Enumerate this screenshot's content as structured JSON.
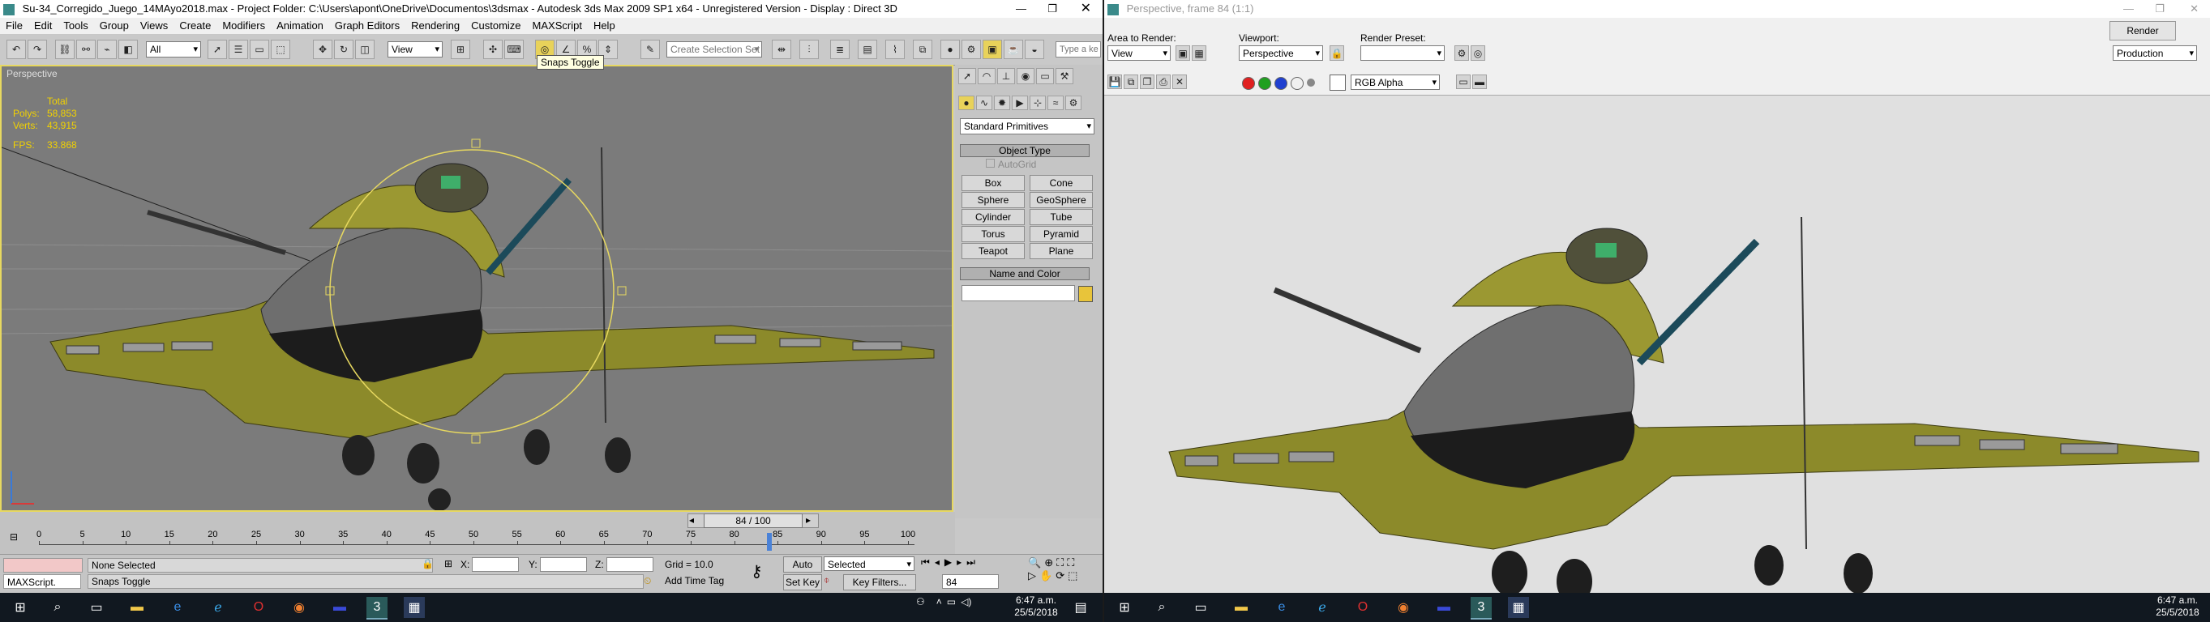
{
  "left": {
    "title": "Su-34_Corregido_Juego_14MAyo2018.max    - Project Folder: C:\\Users\\apont\\OneDrive\\Documentos\\3dsmax    - Autodesk 3ds Max  2009 SP1  x64    - Unregistered Version    - Display : Direct 3D",
    "menu": [
      "File",
      "Edit",
      "Tools",
      "Group",
      "Views",
      "Create",
      "Modifiers",
      "Animation",
      "Graph Editors",
      "Rendering",
      "Customize",
      "MAXScript",
      "Help"
    ],
    "toolbar": {
      "filter_value": "All",
      "coord_value": "View",
      "selection_set_placeholder": "Create Selection Set",
      "search_placeholder": "Type a ke",
      "tooltip": "Snaps Toggle"
    },
    "viewport": {
      "label": "Perspective",
      "stats": {
        "total_label": "Total",
        "polys_label": "Polys:",
        "polys_value": "58,853",
        "verts_label": "Verts:",
        "verts_value": "43,915",
        "fps_label": "FPS:",
        "fps_value": "33.868"
      }
    },
    "command_panel": {
      "category": "Standard Primitives",
      "object_type_title": "Object Type",
      "autogrid_label": "AutoGrid",
      "primitives": [
        "Box",
        "Cone",
        "Sphere",
        "GeoSphere",
        "Cylinder",
        "Tube",
        "Torus",
        "Pyramid",
        "Teapot",
        "Plane"
      ],
      "name_color_title": "Name and Color"
    },
    "timeline": {
      "frame_label": "84 / 100",
      "ticks": [
        "0",
        "5",
        "10",
        "15",
        "20",
        "25",
        "30",
        "35",
        "40",
        "45",
        "50",
        "55",
        "60",
        "65",
        "70",
        "75",
        "80",
        "85",
        "90",
        "95",
        "100"
      ]
    },
    "status": {
      "maxscript_label": "MAXScript.",
      "selection_text": "None Selected",
      "prompt_text": "Snaps Toggle",
      "x_label": "X:",
      "y_label": "Y:",
      "z_label": "Z:",
      "grid_text": "Grid = 10.0",
      "add_time_tag": "Add Time Tag",
      "auto_key": "Auto Key",
      "set_key": "Set Key",
      "key_mode_value": "Selected",
      "key_filters": "Key Filters...",
      "current_frame": "84"
    },
    "clock": {
      "time": "6:47 a.m.",
      "date": "25/5/2018"
    }
  },
  "right": {
    "title": "Perspective, frame 84 (1:1)",
    "area_label": "Area to Render:",
    "area_value": "View",
    "viewport_label": "Viewport:",
    "viewport_value": "Perspective",
    "preset_label": "Render Preset:",
    "preset_value": "",
    "render_button": "Render",
    "production_value": "Production",
    "channel_value": "RGB Alpha",
    "clock": {
      "time": "6:47 a.m.",
      "date": "25/5/2018"
    }
  },
  "colors": {
    "viewport_bg": "#7b7b7b",
    "viewport_border": "#e7d860",
    "stats_text": "#f2d200",
    "render_bg": "#e0e0e0",
    "jet_olive": "#8c8a2a",
    "taskbar": "#111820"
  }
}
